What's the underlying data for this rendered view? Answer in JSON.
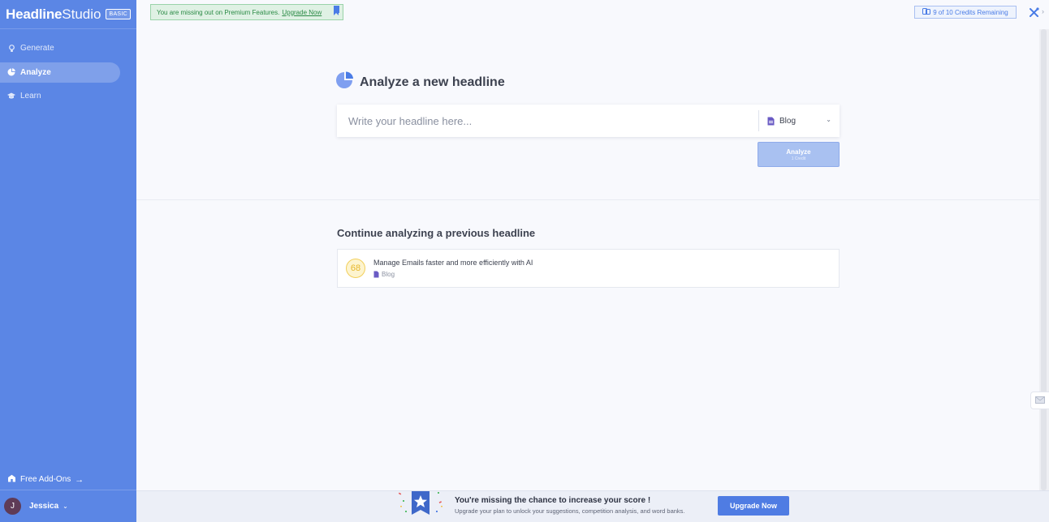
{
  "brand": {
    "name_bold": "Headline",
    "name_light": "Studio",
    "plan": "BASIC"
  },
  "sidebar": {
    "items": [
      {
        "label": "Generate",
        "icon": "lightbulb-icon",
        "active": false
      },
      {
        "label": "Analyze",
        "icon": "pie-chart-icon",
        "active": true
      },
      {
        "label": "Learn",
        "icon": "graduation-cap-icon",
        "active": false
      }
    ],
    "addons_label": "Free Add-Ons",
    "user_initial": "J",
    "user_name": "Jessica"
  },
  "banner": {
    "text": "You are missing out on Premium Features.",
    "link": "Upgrade Now"
  },
  "credits": {
    "text": "9 of 10 Credits Remaining"
  },
  "analyze": {
    "title": "Analyze a new headline",
    "placeholder": "Write your headline here...",
    "content_type": "Blog",
    "button_label": "Analyze",
    "button_sub": "1 Credit"
  },
  "previous": {
    "title": "Continue analyzing a previous headline",
    "items": [
      {
        "score": "68",
        "headline": "Manage Emails faster and more efficiently with AI",
        "type": "Blog"
      }
    ]
  },
  "promo": {
    "title": "You're missing the chance to increase your score !",
    "subtitle": "Upgrade your plan to unlock your suggestions, competition analysis, and word banks.",
    "button": "Upgrade Now"
  },
  "colors": {
    "sidebar": "#5b86e5",
    "accent": "#4a7ce6",
    "score": "#f2cf5a"
  }
}
